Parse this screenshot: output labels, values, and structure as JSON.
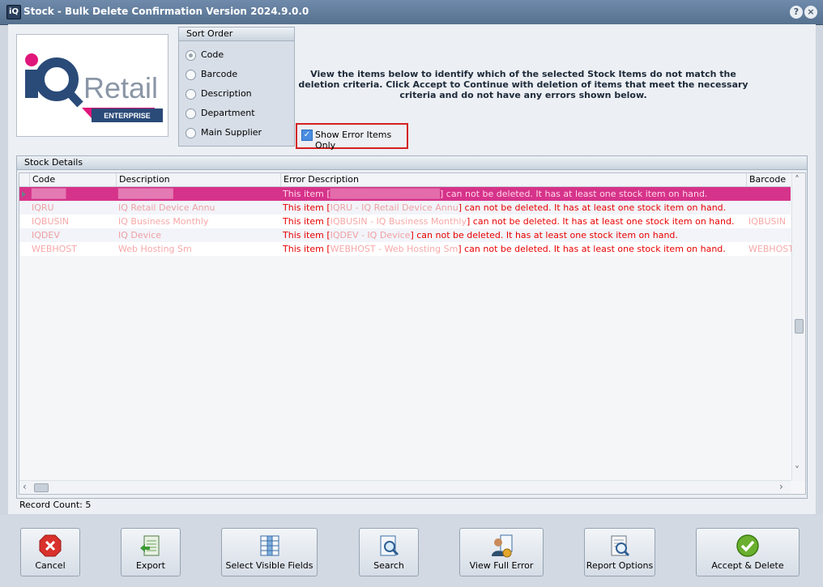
{
  "window": {
    "icon_text": "iQ",
    "title": "Stock - Bulk Delete Confirmation Version 2024.9.0.0",
    "help_glyph": "?",
    "close_glyph": "×"
  },
  "logo": {
    "brand": "iQRetail",
    "tagline": "ENTERPRISE",
    "colors": {
      "pink": "#e0167a",
      "navy": "#2a4a78",
      "gray": "#8a96a6"
    }
  },
  "sort_order": {
    "title": "Sort Order",
    "selected": "Code",
    "options": [
      "Code",
      "Barcode",
      "Description",
      "Department",
      "Main Supplier"
    ]
  },
  "info_message": "View the items below to identify which of the selected Stock Items do not match the deletion criteria.  Click Accept to Continue with deletion of items that meet the necessary criteria and do not have any errors shown below.",
  "error_filter": {
    "label": "Show Error Items Only",
    "checked": true
  },
  "stock_details": {
    "title": "Stock Details",
    "columns": [
      "Code",
      "Description",
      "Error Description",
      "Barcode"
    ],
    "rows": [
      {
        "code": "█████",
        "description": "████████",
        "error_prefix": "This item [",
        "error_suffix": "] can not be deleted. It has at least one stock item on hand.",
        "barcode": "",
        "selected": true
      },
      {
        "code": "IQRU",
        "description": "IQ Retail Device Annu",
        "error_prefix": "This item [",
        "error_suffix": "] can not be deleted. It has at least one stock item on hand.",
        "barcode": ""
      },
      {
        "code": "IQBUSIN",
        "description": "IQ Business Monthly",
        "error_prefix": "This item [",
        "error_suffix": "] can not be deleted. It has at least one stock item on hand.",
        "barcode": "IQBUSIN"
      },
      {
        "code": "IQDEV",
        "description": "IQ Device",
        "error_prefix": "This item [",
        "error_suffix": "] can not be deleted. It has at least one stock item on hand.",
        "barcode": ""
      },
      {
        "code": "WEBHOST",
        "description": "Web Hosting Sm",
        "error_prefix": "This item [",
        "error_suffix": "] can not be deleted. It has at least one stock item on hand.",
        "barcode": "WEBHOST"
      }
    ],
    "record_count_label": "Record Count: 5"
  },
  "buttons": {
    "cancel": "Cancel",
    "export": "Export",
    "select_fields": "Select Visible Fields",
    "search": "Search",
    "view_error": "View Full Error",
    "report_options": "Report Options",
    "accept": "Accept & Delete"
  }
}
